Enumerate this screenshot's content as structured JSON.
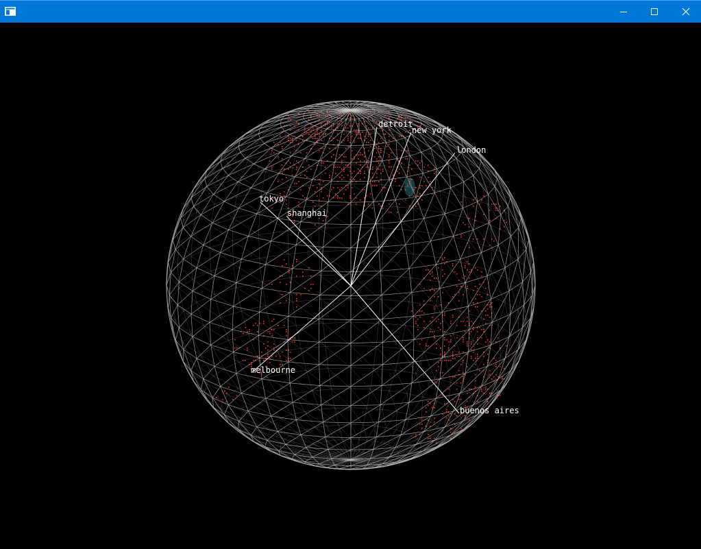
{
  "window": {
    "title": "",
    "icon": "app-window-icon",
    "controls": {
      "minimize_icon": "minimize-icon",
      "maximize_icon": "maximize-icon",
      "close_icon": "close-icon"
    },
    "titlebar_color": "#0078d7"
  },
  "globe": {
    "background_color": "#000000",
    "wireframe_color": "#c8c8c8",
    "land_color": "#ff2a2a",
    "water_highlight_color": "#3fb0b0",
    "cities": [
      {
        "name": "detroit"
      },
      {
        "name": "new york"
      },
      {
        "name": "london"
      },
      {
        "name": "tokyo"
      },
      {
        "name": "shanghai"
      },
      {
        "name": "melbourne"
      },
      {
        "name": "buenos aires"
      }
    ]
  }
}
